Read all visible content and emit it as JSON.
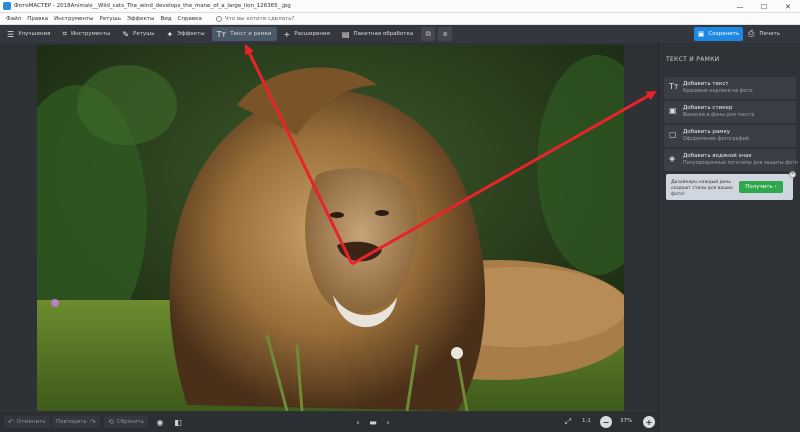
{
  "window": {
    "title": "ФотоМАСТЕР - 2018Animals__Wild_cats_The_wind_develops_the_mane_of_a_large_lion_126365_.jpg",
    "controls": [
      "—",
      "☐",
      "✕"
    ]
  },
  "menu": {
    "items": [
      "Файл",
      "Правка",
      "Инструменты",
      "Ретушь",
      "Эффекты",
      "Вид",
      "Справка"
    ],
    "help_search": "Что вы хотите сделать?"
  },
  "toolbar": {
    "tabs": [
      {
        "label": "Улучшения",
        "icon": "sliders-icon",
        "glyph": "☰"
      },
      {
        "label": "Инструменты",
        "icon": "crop-icon",
        "glyph": "⌗"
      },
      {
        "label": "Ретушь",
        "icon": "brush-icon",
        "glyph": "✎"
      },
      {
        "label": "Эффекты",
        "icon": "magic-wand-icon",
        "glyph": "✦"
      },
      {
        "label": "Текст и рамки",
        "icon": "text-icon",
        "glyph": "Tт"
      },
      {
        "label": "Расширения",
        "icon": "plus-icon",
        "glyph": "+"
      },
      {
        "label": "Пакетная обработка",
        "icon": "batch-icon",
        "glyph": "▤"
      }
    ],
    "active_tab": "Текст и рамки",
    "save_label": "Сохранить",
    "print_label": "Печать",
    "accent": "#1e88e5"
  },
  "panel": {
    "title": "ТЕКСТ И РАМКИ",
    "items": [
      {
        "title": "Добавить текст",
        "subtitle": "Красивые надписи на фото",
        "icon": "text-tool-icon",
        "glyph": "Tт"
      },
      {
        "title": "Добавить стикер",
        "subtitle": "Выноски и фоны для текста",
        "icon": "sticker-icon",
        "glyph": "▣"
      },
      {
        "title": "Добавить рамку",
        "subtitle": "Оформление фотографий",
        "icon": "frame-icon",
        "glyph": "▢"
      },
      {
        "title": "Добавить водяной знак",
        "subtitle": "Полупрозрачные логотипы для защиты фото",
        "icon": "watermark-icon",
        "glyph": "◈"
      }
    ],
    "promo": {
      "text": "Дизайнеры каждый день создают стили для ваших фото!",
      "button": "Получить",
      "button_color": "#2ea84a"
    }
  },
  "bottom": {
    "undo": "Отменить",
    "redo": "Повторить",
    "reset": "Сбросить",
    "zoom_fit": "1:1",
    "zoom_level": "37%"
  },
  "annotation": {
    "arrow_color": "#e8232a"
  }
}
